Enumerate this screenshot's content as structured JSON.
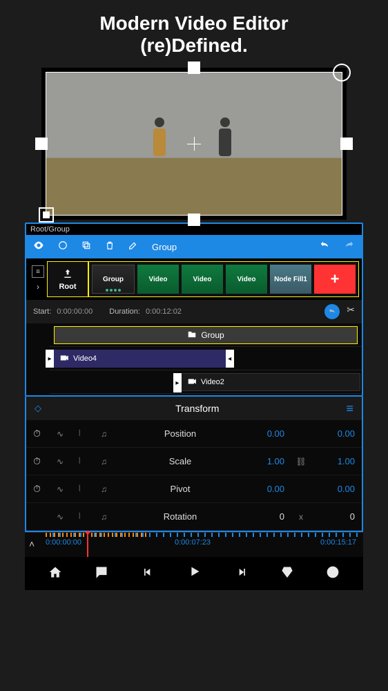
{
  "promo": {
    "line1": "Modern Video Editor",
    "line2": "(re)Defined."
  },
  "breadcrumb": "Root/Group",
  "toolbar": {
    "group_label": "Group"
  },
  "clips": {
    "root_label": "Root",
    "group_label": "Group",
    "video_label": "Video",
    "fill_label": "Node Fill1"
  },
  "timing": {
    "start_label": "Start:",
    "start_value": "0:00:00:00",
    "duration_label": "Duration:",
    "duration_value": "0:00:12:02"
  },
  "tracks": {
    "group_label": "Group",
    "video4_label": "Video4",
    "video2_label": "Video2"
  },
  "transform": {
    "title": "Transform",
    "rows": [
      {
        "label": "Position",
        "v1": "0.00",
        "v2": "0.00",
        "link": false
      },
      {
        "label": "Scale",
        "v1": "1.00",
        "v2": "1.00",
        "link": true
      },
      {
        "label": "Pivot",
        "v1": "0.00",
        "v2": "0.00",
        "link": false
      },
      {
        "label": "Rotation",
        "v1": "0",
        "sep": "x",
        "v2": "0",
        "link": false
      }
    ]
  },
  "ruler": {
    "t1": "0:00:00:00",
    "t2": "0:00:07:23",
    "t3": "0:00:15:17"
  }
}
